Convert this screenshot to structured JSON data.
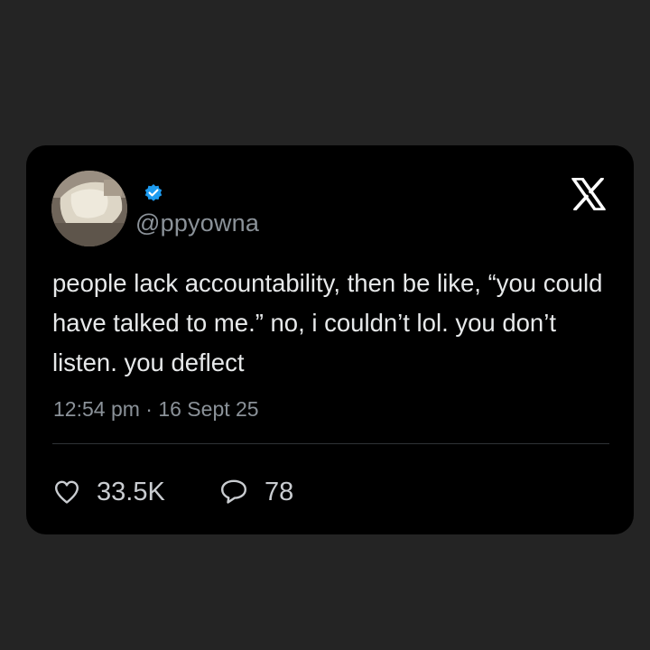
{
  "tweet": {
    "handle": "@ppyowna",
    "verified_icon": "verified-badge-icon",
    "brand_icon": "x-logo-icon",
    "text": "people lack accountability, then be like, “you could have talked to me.” no, i couldn’t lol. you don’t listen. you deflect",
    "timestamp": "12:54 pm · 16 Sept 25",
    "likes": "33.5K",
    "replies": "78"
  },
  "colors": {
    "background": "#242424",
    "card": "#000000",
    "verified_blue": "#1d9bf0",
    "text_primary": "#e7e9ea",
    "text_secondary": "#8b9299"
  }
}
